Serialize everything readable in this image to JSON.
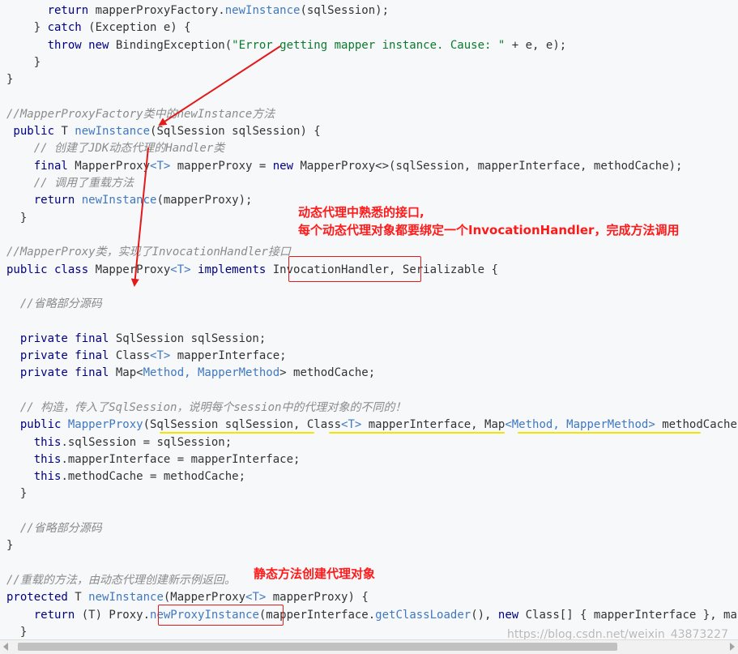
{
  "code_lines": [
    [
      [
        "    return mapperProxyFactory.",
        "k-mix"
      ]
    ],
    [],
    [],
    [],
    [],
    [],
    [],
    [],
    [],
    [],
    [],
    [],
    [],
    [],
    [],
    [],
    [],
    [],
    [],
    [],
    [],
    [],
    [],
    [],
    [],
    [],
    [],
    [],
    [],
    [],
    [],
    [],
    [],
    [],
    [],
    [],
    []
  ],
  "lines": [
    [
      [
        "      return ",
        "k"
      ],
      [
        "mapperProxyFactory.",
        "p"
      ],
      [
        "newInstance",
        "m"
      ],
      [
        "(sqlSession);",
        "p"
      ]
    ],
    [
      [
        "    } ",
        "p"
      ],
      [
        "catch",
        "k"
      ],
      [
        " (Exception e) {",
        "p"
      ]
    ],
    [
      [
        "      throw new ",
        "k"
      ],
      [
        "BindingException(",
        "p"
      ],
      [
        "\"Error getting mapper instance. Cause: \"",
        "s"
      ],
      [
        " + e, e);",
        "p"
      ]
    ],
    [
      [
        "    }",
        "p"
      ]
    ],
    [
      [
        "}",
        "p"
      ]
    ],
    [],
    [
      [
        "//MapperProxyFactory类中的newInstance方法",
        "c"
      ]
    ],
    [
      [
        " public ",
        "k"
      ],
      [
        "T ",
        "p"
      ],
      [
        "newInstance",
        "m"
      ],
      [
        "(SqlSession sqlSession) {",
        "p"
      ]
    ],
    [
      [
        "    // 创建了JDK动态代理的Handler类",
        "c"
      ]
    ],
    [
      [
        "    final ",
        "k"
      ],
      [
        "MapperProxy",
        "p"
      ],
      [
        "<T>",
        "m"
      ],
      [
        " mapperProxy = ",
        "p"
      ],
      [
        "new ",
        "k"
      ],
      [
        "MapperProxy<>(sqlSession, mapperInterface, methodCache);",
        "p"
      ]
    ],
    [
      [
        "    // 调用了重载方法",
        "c"
      ]
    ],
    [
      [
        "    return ",
        "k"
      ],
      [
        "newInstance",
        "m"
      ],
      [
        "(mapperProxy);",
        "p"
      ]
    ],
    [
      [
        "  }",
        "p"
      ]
    ],
    [],
    [
      [
        "//MapperProxy类，实现了InvocationHandler接口",
        "c"
      ]
    ],
    [
      [
        "public class ",
        "k"
      ],
      [
        "MapperProxy",
        "p"
      ],
      [
        "<T>",
        "m"
      ],
      [
        " implements ",
        "k"
      ],
      [
        "InvocationHandler, Serializable {",
        "p"
      ]
    ],
    [],
    [
      [
        "  //省略部分源码",
        "c"
      ]
    ],
    [],
    [
      [
        "  private final ",
        "k"
      ],
      [
        "SqlSession sqlSession;",
        "p"
      ]
    ],
    [
      [
        "  private final ",
        "k"
      ],
      [
        "Class",
        "p"
      ],
      [
        "<T>",
        "m"
      ],
      [
        " mapperInterface;",
        "p"
      ]
    ],
    [
      [
        "  private final ",
        "k"
      ],
      [
        "Map<",
        "p"
      ],
      [
        "Method, MapperMethod",
        "m"
      ],
      [
        "> methodCache;",
        "p"
      ]
    ],
    [],
    [
      [
        "  // 构造，传入了SqlSession，说明每个session中的代理对象的不同的！",
        "c"
      ]
    ],
    [
      [
        "  public ",
        "k"
      ],
      [
        "MapperProxy",
        "m"
      ],
      [
        "(SqlSession sqlSession, Class",
        "p"
      ],
      [
        "<T>",
        "m"
      ],
      [
        " mapperInterface, Map",
        "p"
      ],
      [
        "<Method, MapperMethod>",
        "m"
      ],
      [
        " methodCache) {",
        "p"
      ]
    ],
    [
      [
        "    this",
        "k"
      ],
      [
        ".sqlSession = sqlSession;",
        "p"
      ]
    ],
    [
      [
        "    this",
        "k"
      ],
      [
        ".mapperInterface = mapperInterface;",
        "p"
      ]
    ],
    [
      [
        "    this",
        "k"
      ],
      [
        ".methodCache = methodCache;",
        "p"
      ]
    ],
    [
      [
        "  }",
        "p"
      ]
    ],
    [],
    [
      [
        "  //省略部分源码",
        "c"
      ]
    ],
    [
      [
        "}",
        "p"
      ]
    ],
    [],
    [
      [
        "//重载的方法，由动态代理创建新示例返回。",
        "c"
      ]
    ],
    [
      [
        "protected ",
        "k"
      ],
      [
        "T ",
        "p"
      ],
      [
        "newInstance",
        "m"
      ],
      [
        "(MapperProxy",
        "p"
      ],
      [
        "<T>",
        "m"
      ],
      [
        " mapperProxy) {",
        "p"
      ]
    ],
    [
      [
        "    return ",
        "k"
      ],
      [
        "(T) Proxy.",
        "p"
      ],
      [
        "newProxyInstance",
        "m"
      ],
      [
        "(mapperInterface.",
        "p"
      ],
      [
        "getClassLoader",
        "m"
      ],
      [
        "(), ",
        "p"
      ],
      [
        "new ",
        "k"
      ],
      [
        "Class[] { mapperInterface }, mapperProxy);",
        "p"
      ]
    ],
    [
      [
        "  }",
        "p"
      ]
    ]
  ],
  "annotations": {
    "note_invocation_handler": "动态代理中熟悉的接口,\n每个动态代理对象都要绑定一个InvocationHandler，完成方法调用",
    "note_static_method": "静态方法创建代理对象"
  },
  "colors": {
    "keyword": "#000080",
    "method": "#4078c0",
    "string": "#0c7a2c",
    "comment": "#8b8b8b",
    "annotation": "#ff1a1a",
    "highlight_box": "#e21a1a",
    "underline": "#f2e600"
  },
  "watermark": "https://blog.csdn.net/weixin_43873227"
}
